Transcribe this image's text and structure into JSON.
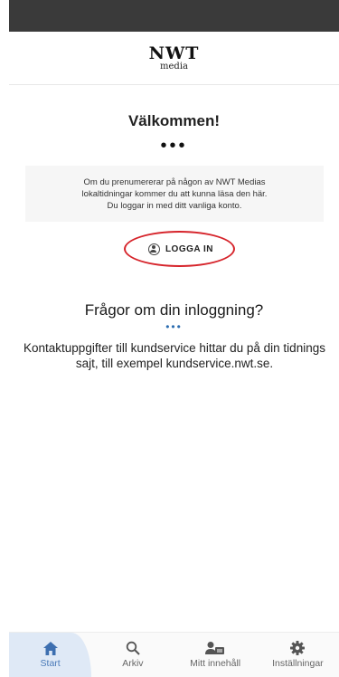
{
  "header": {
    "logo_main": "NWT",
    "logo_sub": "media"
  },
  "welcome": {
    "title": "Välkommen!",
    "dots": "•••",
    "info_lines": [
      "Om du prenumererar på någon av NWT Medias",
      "lokaltidningar kommer du att kunna läsa den här.",
      "Du loggar in med ditt vanliga konto."
    ],
    "login_label": "LOGGA IN"
  },
  "help": {
    "title": "Frågor om din inloggning?",
    "dots": "•••",
    "text": "Kontaktuppgifter till kundservice hittar du på din tidnings sajt, till exempel kundservice.nwt.se."
  },
  "bottom_nav": {
    "items": [
      {
        "label": "Start",
        "icon": "home-icon",
        "active": true
      },
      {
        "label": "Arkiv",
        "icon": "search-icon",
        "active": false
      },
      {
        "label": "Mitt innehåll",
        "icon": "user-card-icon",
        "active": false
      },
      {
        "label": "Inställningar",
        "icon": "gear-icon",
        "active": false
      }
    ]
  },
  "colors": {
    "highlight_oval": "#d6242b",
    "active_nav_bg": "#dfe9f6",
    "active_nav_fg": "#4a7ab8",
    "status_bar": "#3a3a3a"
  }
}
